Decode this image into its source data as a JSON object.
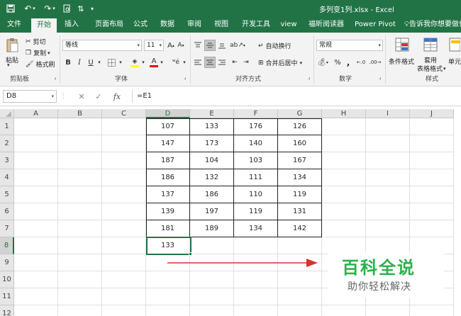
{
  "window": {
    "title": "多列变1列.xlsx  -  Excel"
  },
  "ribbon_tabs": [
    "文件",
    "开始",
    "插入",
    "页面布局",
    "公式",
    "数据",
    "审阅",
    "视图",
    "开发工具",
    "view",
    "福昕阅读器",
    "Power Pivot"
  ],
  "active_tab": "开始",
  "tell_me": "告诉我你想要做什",
  "clipboard": {
    "paste": "粘贴",
    "cut": "剪切",
    "copy": "复制",
    "format_painter": "格式刷",
    "group": "剪贴板"
  },
  "font": {
    "name": "等线",
    "size": "11",
    "bold": "B",
    "italic": "I",
    "underline": "U",
    "group": "字体"
  },
  "alignment": {
    "wrap": "自动换行",
    "merge": "合并后居中",
    "group": "对齐方式"
  },
  "number": {
    "format": "常规",
    "group": "数字"
  },
  "styles": {
    "conditional": "条件格式",
    "table_format_1": "套用",
    "table_format_2": "表格格式",
    "cell_style": "单元",
    "group": "样式"
  },
  "formula_bar": {
    "name_box": "D8",
    "formula": "=E1",
    "fx": "fx"
  },
  "columns": [
    "A",
    "B",
    "C",
    "D",
    "E",
    "F",
    "G",
    "H",
    "I",
    "J"
  ],
  "rows": [
    "1",
    "2",
    "3",
    "4",
    "5",
    "6",
    "7",
    "8",
    "9",
    "10",
    "11",
    "12"
  ],
  "table": [
    [
      "107",
      "133",
      "176",
      "126"
    ],
    [
      "147",
      "173",
      "140",
      "160"
    ],
    [
      "187",
      "104",
      "103",
      "167"
    ],
    [
      "186",
      "132",
      "111",
      "134"
    ],
    [
      "137",
      "186",
      "110",
      "119"
    ],
    [
      "139",
      "197",
      "119",
      "131"
    ],
    [
      "181",
      "189",
      "134",
      "142"
    ]
  ],
  "active_cell_value": "133",
  "watermark": {
    "title": "百科全说",
    "subtitle": "助你轻松解决"
  },
  "colors": {
    "excel_green": "#217346",
    "arrow_red": "#d9302b",
    "watermark_green": "#2bb24c"
  }
}
